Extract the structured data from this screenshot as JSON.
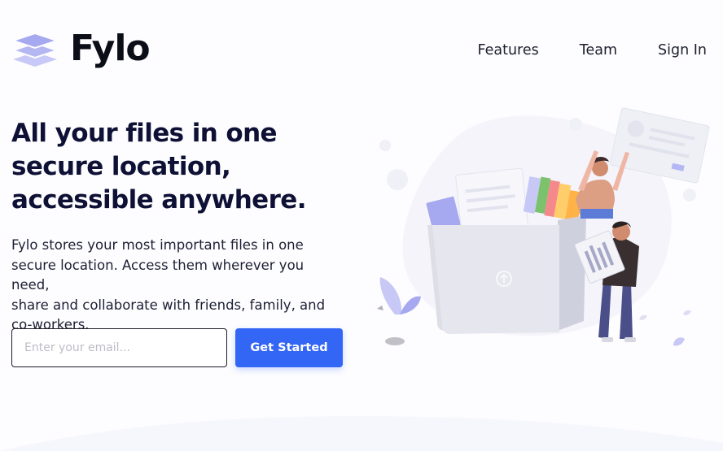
{
  "brand": {
    "name": "Fylo",
    "logo_icon": "stacked-layers-icon",
    "color": "#0b0d17"
  },
  "nav": {
    "items": [
      "Features",
      "Team",
      "Sign In"
    ]
  },
  "hero": {
    "headline_lines": [
      "All your files in one",
      "secure location,",
      "accessible anywhere."
    ],
    "description_lines": [
      "Fylo stores your most important files in one",
      "secure location. Access them wherever you need,",
      "share and collaborate with friends, family, and",
      "co-workers."
    ],
    "email_placeholder": "Enter your email...",
    "email_value": "",
    "cta_label": "Get Started",
    "illustration": "people-filing-documents-illustration"
  },
  "colors": {
    "accent": "#3466f6",
    "headline": "#0e1135",
    "logo_purple": "#a6a8f0",
    "text": "#1d1f33"
  }
}
